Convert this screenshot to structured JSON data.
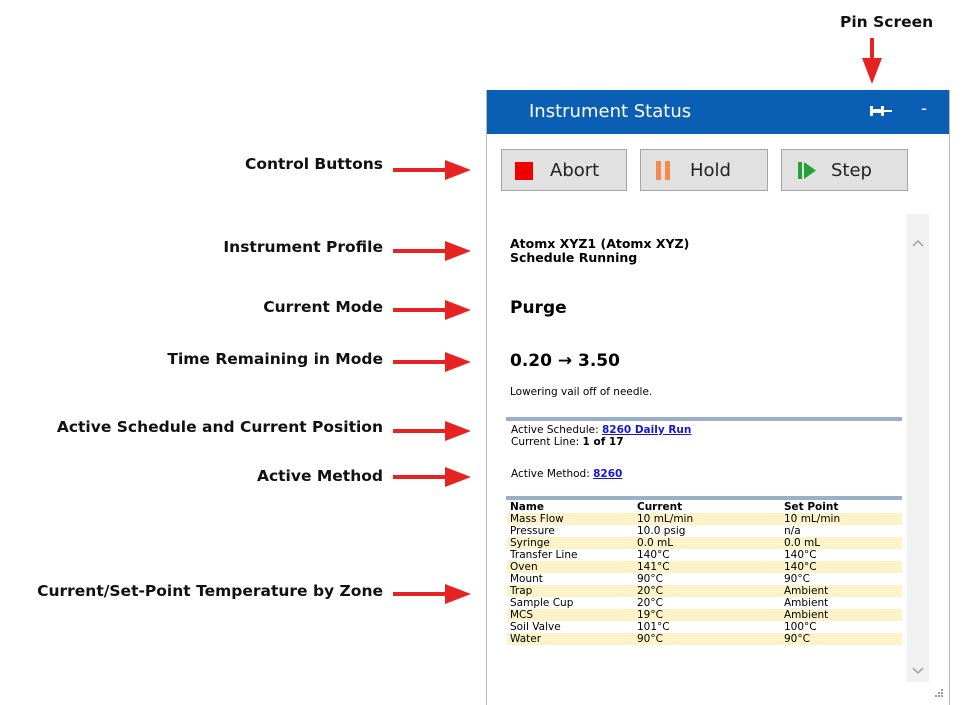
{
  "callouts": {
    "pin_screen": "Pin Screen",
    "control_buttons": "Control Buttons",
    "instrument_profile": "Instrument Profile",
    "current_mode": "Current Mode",
    "time_remaining": "Time Remaining in Mode",
    "active_schedule": "Active Schedule and Current Position",
    "active_method": "Active Method",
    "temperature": "Current/Set-Point Temperature by Zone"
  },
  "window": {
    "title": "Instrument Status",
    "minimize_label": "-"
  },
  "controls": {
    "abort_label": "Abort",
    "hold_label": "Hold",
    "step_label": "Step"
  },
  "status": {
    "profile_line1": "Atomx XYZ1 (Atomx XYZ)",
    "profile_line2": "Schedule Running",
    "mode": "Purge",
    "time_remaining": "0.20 → 3.50",
    "note": "Lowering vail off of needle.",
    "schedule_label": "Active Schedule: ",
    "schedule_value": "8260 Daily Run",
    "line_label": "Current Line: ",
    "line_value": "1 of 17",
    "method_label": "Active Method: ",
    "method_value": "8260"
  },
  "zones": {
    "headers": [
      "Name",
      "Current",
      "Set Point"
    ],
    "rows": [
      [
        "Mass Flow",
        "10 mL/min",
        "10 mL/min"
      ],
      [
        "Pressure",
        "10.0 psig",
        "n/a"
      ],
      [
        "Syringe",
        "0.0 mL",
        "0.0 mL"
      ],
      [
        "Transfer Line",
        "140°C",
        "140°C"
      ],
      [
        "Oven",
        "141°C",
        "140°C"
      ],
      [
        "Mount",
        "90°C",
        "90°C"
      ],
      [
        "Trap",
        "20°C",
        "Ambient"
      ],
      [
        "Sample Cup",
        "20°C",
        "Ambient"
      ],
      [
        "MCS",
        "19°C",
        "Ambient"
      ],
      [
        "Soil Valve",
        "101°C",
        "100°C"
      ],
      [
        "Water",
        "90°C",
        "90°C"
      ]
    ]
  },
  "colors": {
    "titlebar": "#0a5fb4",
    "arrow": "#e52421",
    "abort_icon": "#f00000",
    "hold_icon": "#f28c4a",
    "step_icon": "#21a33a",
    "link": "#1515d6",
    "row_highlight": "#fdf3c8"
  },
  "icons": {
    "pin": "pin-icon",
    "abort": "stop-square-icon",
    "hold": "pause-icon",
    "step": "step-forward-icon"
  }
}
